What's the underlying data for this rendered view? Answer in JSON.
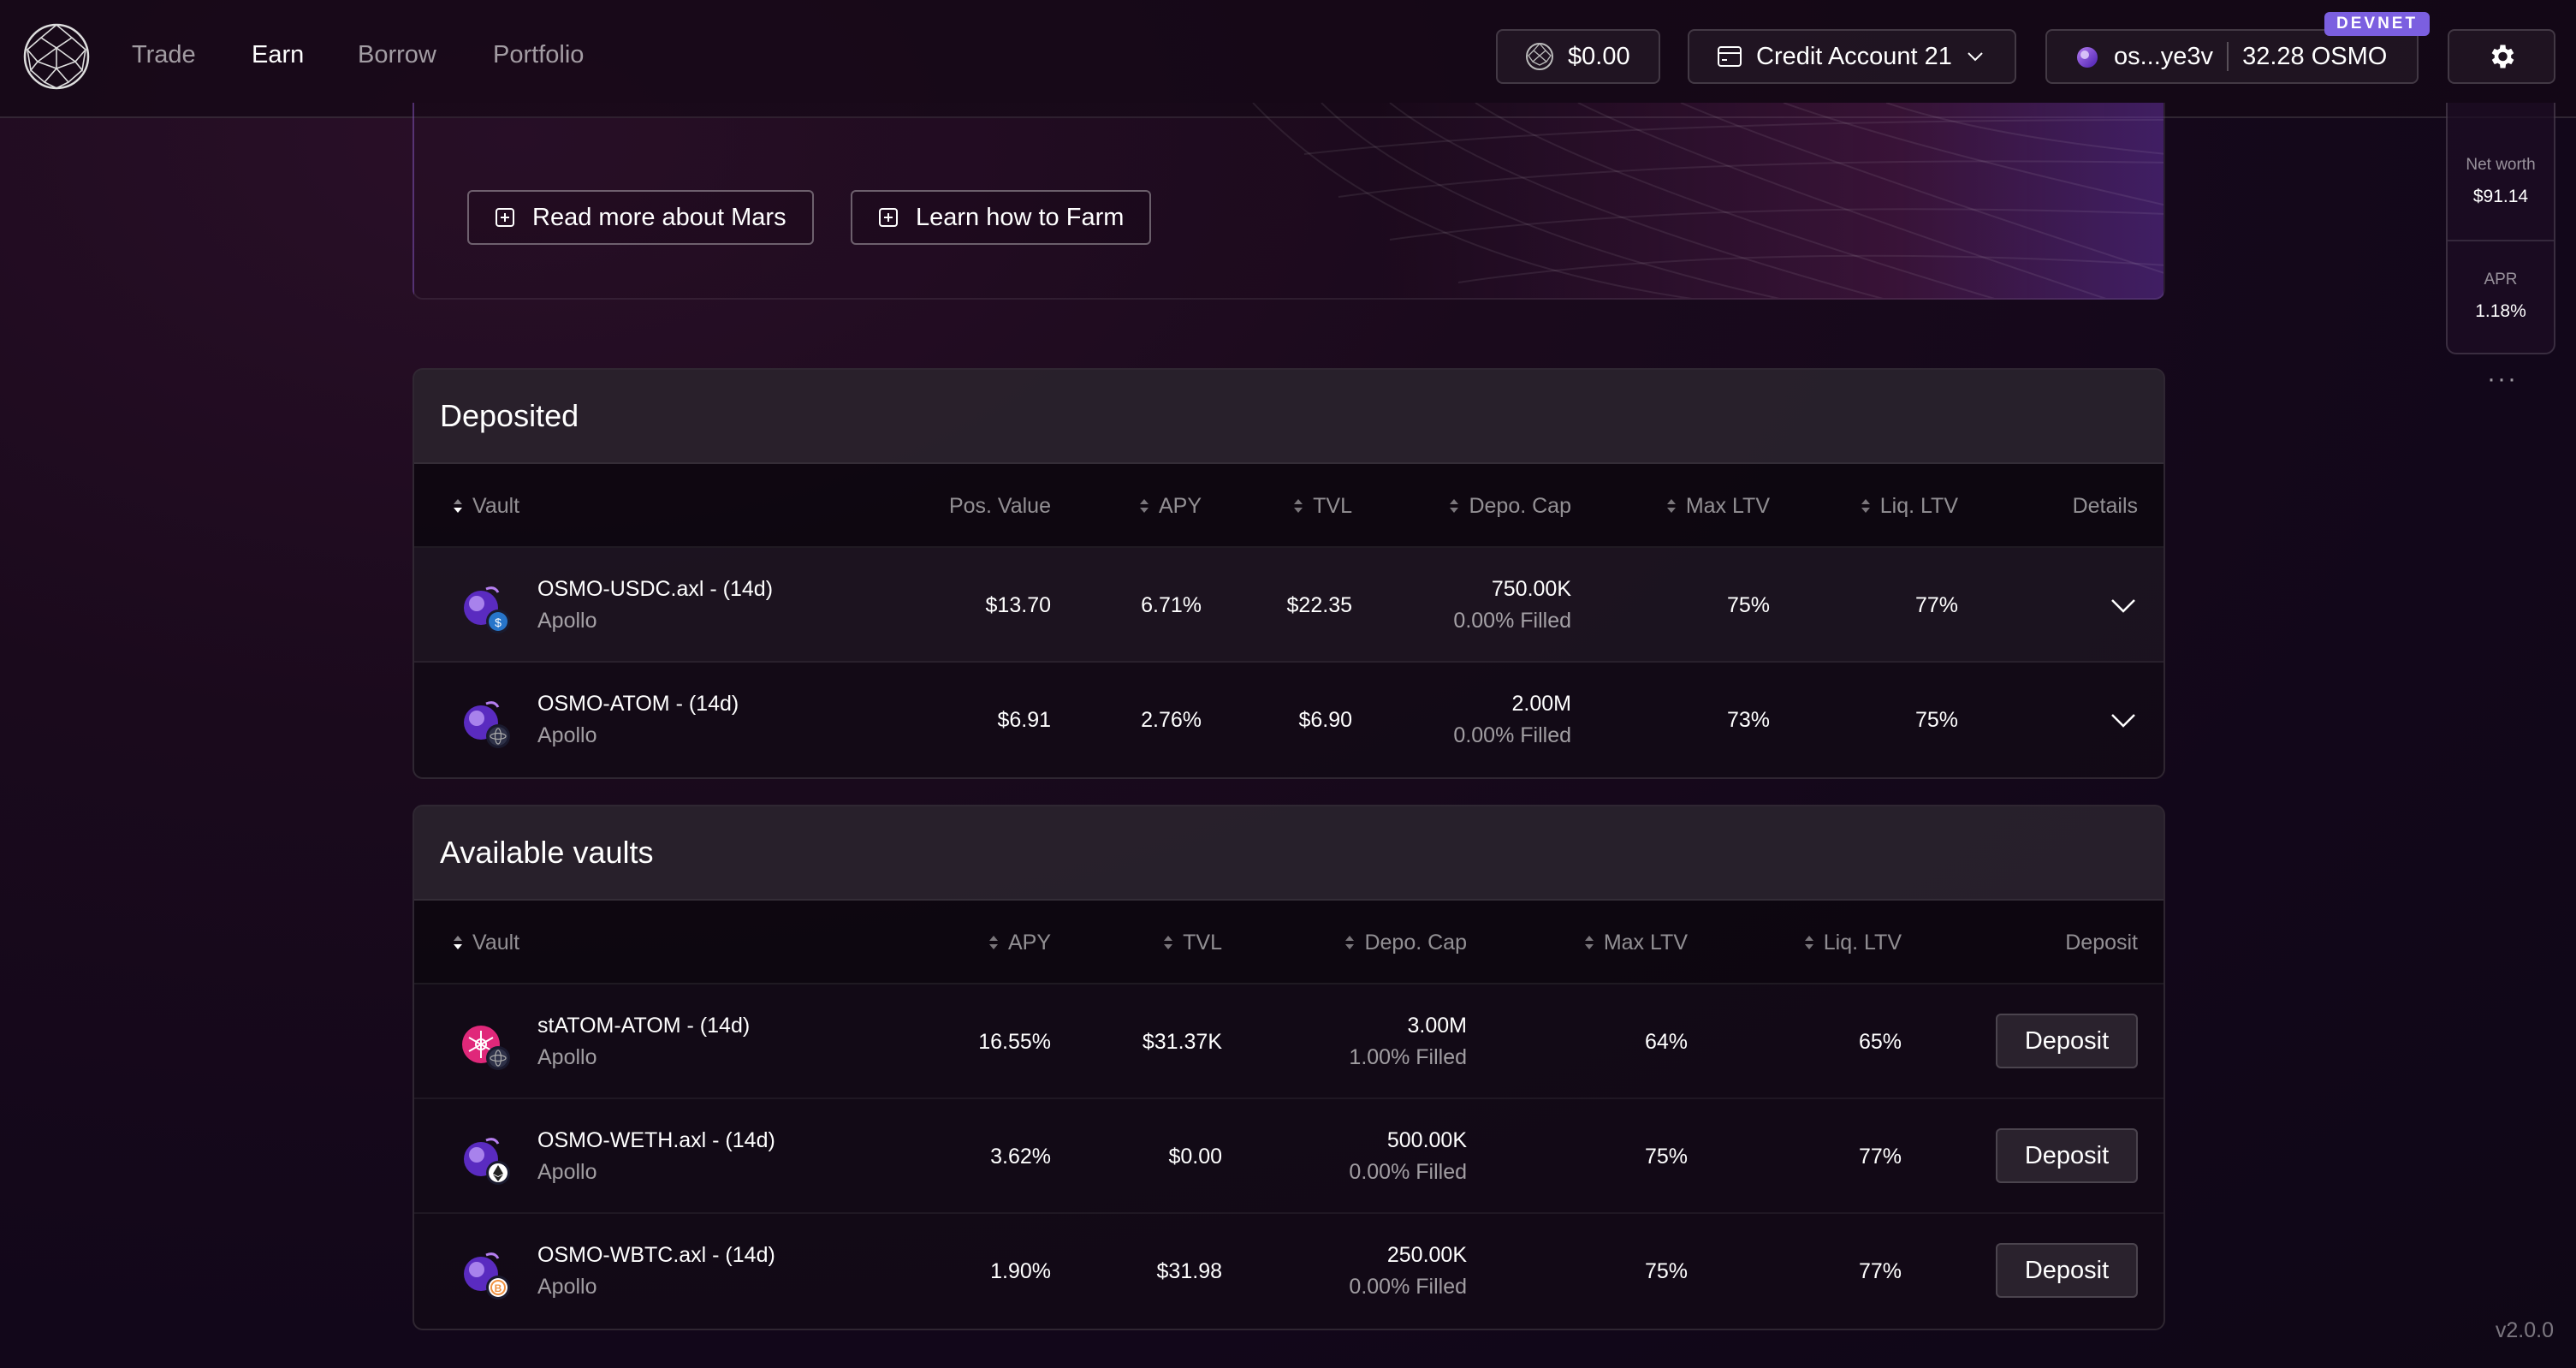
{
  "nav": {
    "items": [
      {
        "label": "Trade",
        "active": false
      },
      {
        "label": "Earn",
        "active": true
      },
      {
        "label": "Borrow",
        "active": false
      },
      {
        "label": "Portfolio",
        "active": false
      }
    ]
  },
  "header": {
    "balance": "$0.00",
    "credit_account": "Credit Account 21",
    "wallet_address": "os...ye3v",
    "wallet_balance": "32.28 OSMO",
    "network_badge": "DEVNET"
  },
  "hero": {
    "read_more_label": "Read more about Mars",
    "learn_label": "Learn how to Farm"
  },
  "deposited": {
    "title": "Deposited",
    "columns": {
      "vault": "Vault",
      "pos_value": "Pos. Value",
      "apy": "APY",
      "tvl": "TVL",
      "depo_cap": "Depo. Cap",
      "max_ltv": "Max LTV",
      "liq_ltv": "Liq. LTV",
      "details": "Details"
    },
    "rows": [
      {
        "name": "OSMO-USDC.axl - (14d)",
        "provider": "Apollo",
        "pos_value": "$13.70",
        "apy": "6.71%",
        "tvl": "$22.35",
        "cap": "750.00K",
        "filled": "0.00% Filled",
        "max_ltv": "75%",
        "liq_ltv": "77%"
      },
      {
        "name": "OSMO-ATOM - (14d)",
        "provider": "Apollo",
        "pos_value": "$6.91",
        "apy": "2.76%",
        "tvl": "$6.90",
        "cap": "2.00M",
        "filled": "0.00% Filled",
        "max_ltv": "73%",
        "liq_ltv": "75%"
      }
    ]
  },
  "available": {
    "title": "Available vaults",
    "columns": {
      "vault": "Vault",
      "apy": "APY",
      "tvl": "TVL",
      "depo_cap": "Depo. Cap",
      "max_ltv": "Max LTV",
      "liq_ltv": "Liq. LTV",
      "deposit": "Deposit"
    },
    "deposit_label": "Deposit",
    "rows": [
      {
        "name": "stATOM-ATOM - (14d)",
        "provider": "Apollo",
        "apy": "16.55%",
        "tvl": "$31.37K",
        "cap": "3.00M",
        "filled": "1.00% Filled",
        "max_ltv": "64%",
        "liq_ltv": "65%"
      },
      {
        "name": "OSMO-WETH.axl - (14d)",
        "provider": "Apollo",
        "apy": "3.62%",
        "tvl": "$0.00",
        "cap": "500.00K",
        "filled": "0.00% Filled",
        "max_ltv": "75%",
        "liq_ltv": "77%"
      },
      {
        "name": "OSMO-WBTC.axl - (14d)",
        "provider": "Apollo",
        "apy": "1.90%",
        "tvl": "$31.98",
        "cap": "250.00K",
        "filled": "0.00% Filled",
        "max_ltv": "75%",
        "liq_ltv": "77%"
      }
    ]
  },
  "summary": {
    "net_worth_label": "Net worth",
    "net_worth": "$91.14",
    "apr_label": "APR",
    "apr": "1.18%"
  },
  "version": "v2.0.0",
  "colors": {
    "accent": "#7b5fe0",
    "osmo_purple": "#6b3fd0",
    "usdc_blue": "#2775ca",
    "stride_pink": "#e0287a"
  }
}
